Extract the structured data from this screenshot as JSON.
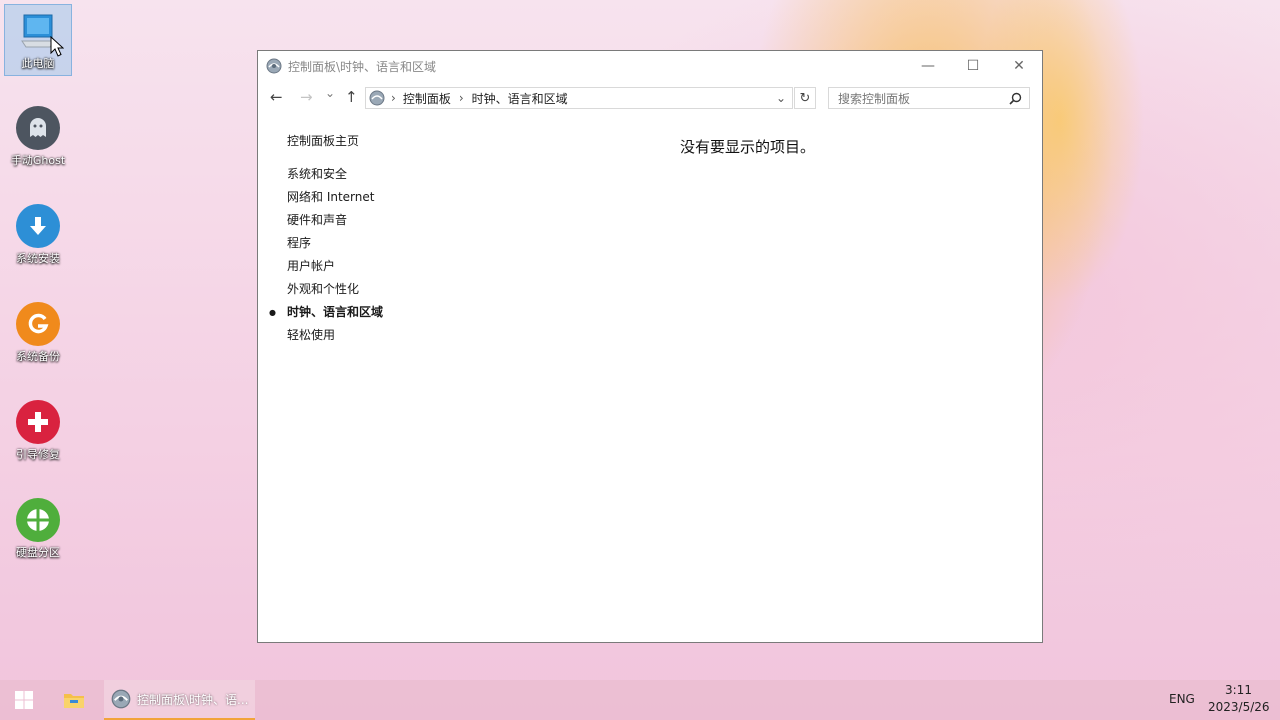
{
  "desktop": {
    "icons": [
      {
        "label": "此电脑",
        "icon": "computer-icon"
      },
      {
        "label": "手动Ghost",
        "icon": "ghost-icon"
      },
      {
        "label": "系统安装",
        "icon": "download-arrow-icon"
      },
      {
        "label": "系统备份",
        "icon": "backup-g-icon"
      },
      {
        "label": "引导修复",
        "icon": "plus-repair-icon"
      },
      {
        "label": "硬盘分区",
        "icon": "disk-partition-icon"
      }
    ]
  },
  "window": {
    "title": "控制面板\\时钟、语言和区域",
    "controls": {
      "minimize": "—",
      "maximize": "☐",
      "close": "✕"
    },
    "nav": {
      "back": "←",
      "forward": "→",
      "recent": "⌄",
      "up": "↑"
    },
    "address": {
      "segments": [
        "控制面板",
        "时钟、语言和区域"
      ],
      "separator": "›",
      "dropdown": "⌄",
      "refresh": "↻"
    },
    "search": {
      "placeholder": "搜索控制面板",
      "icon": "magnifier-icon"
    },
    "sidebar": {
      "home": "控制面板主页",
      "items": [
        {
          "label": "系统和安全",
          "active": false
        },
        {
          "label": "网络和 Internet",
          "active": false
        },
        {
          "label": "硬件和声音",
          "active": false
        },
        {
          "label": "程序",
          "active": false
        },
        {
          "label": "用户帐户",
          "active": false
        },
        {
          "label": "外观和个性化",
          "active": false
        },
        {
          "label": "时钟、语言和区域",
          "active": true
        },
        {
          "label": "轻松使用",
          "active": false
        }
      ]
    },
    "content": {
      "empty_message": "没有要显示的项目。"
    }
  },
  "taskbar": {
    "start": "windows-logo-icon",
    "explorer": "folder-icon",
    "active_app_label": "控制面板\\时钟、语...",
    "accent": "#f2a43a",
    "language": "ENG",
    "time": "3:11",
    "date": "2023/5/26"
  }
}
